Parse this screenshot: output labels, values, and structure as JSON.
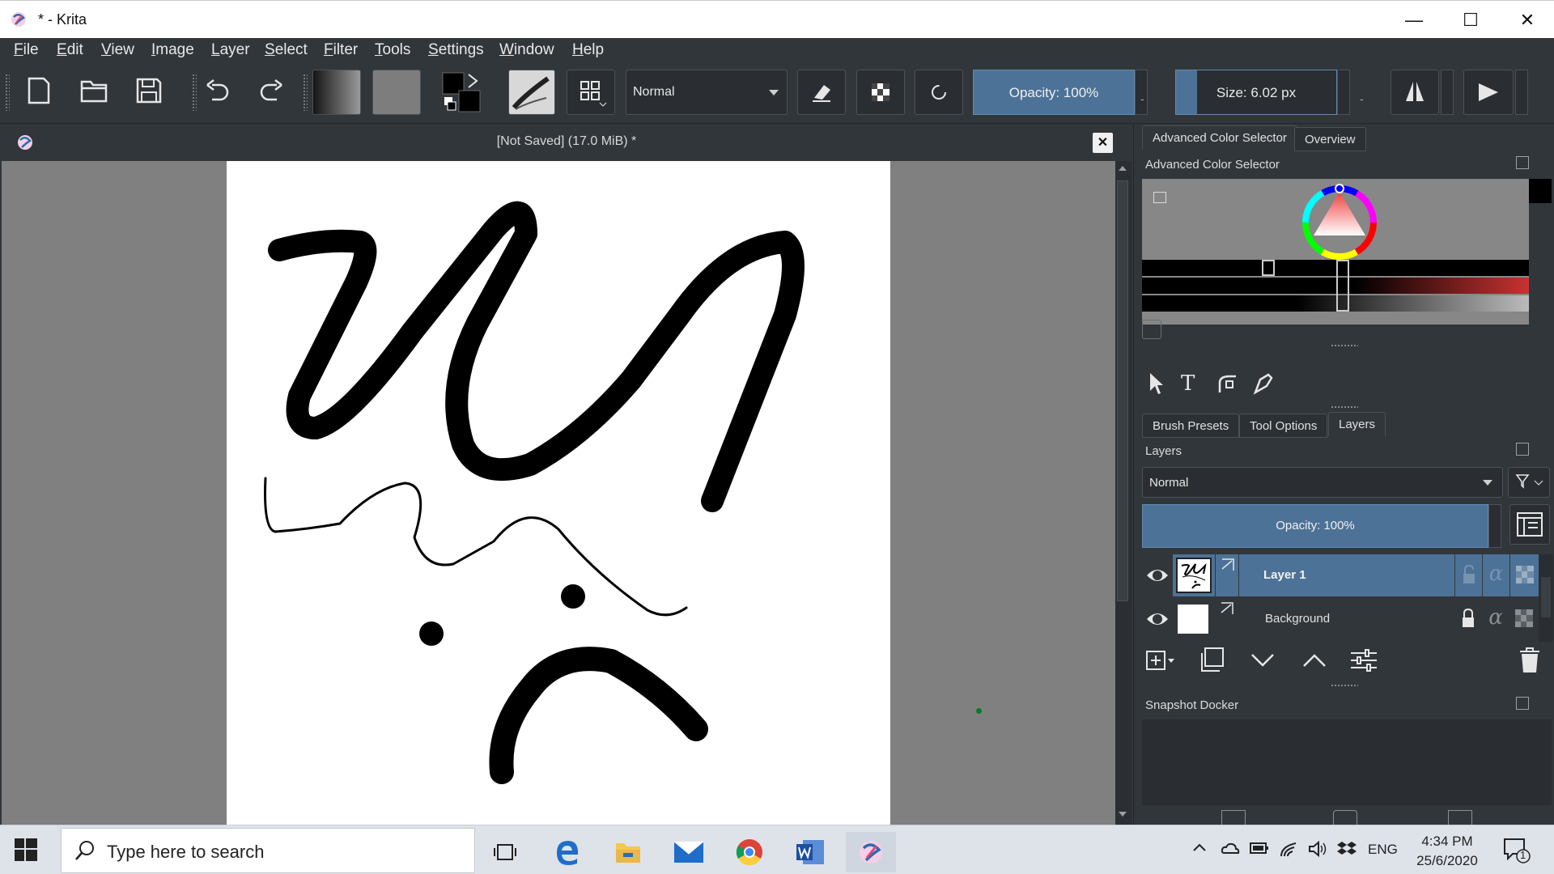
{
  "window": {
    "title": "* - Krita",
    "minimize_glyph": "—",
    "maximize_glyph": "☐",
    "close_glyph": "✕"
  },
  "menu": [
    "File",
    "Edit",
    "View",
    "Image",
    "Layer",
    "Select",
    "Filter",
    "Tools",
    "Settings",
    "Window",
    "Help"
  ],
  "toolbar": {
    "blend_mode": "Normal",
    "opacity_label": "Opacity: 100%",
    "size_label": "Size: 6.02 px",
    "spin_minus": "-",
    "icons": [
      "new-document-icon",
      "open-folder-icon",
      "save-icon",
      "undo-icon",
      "redo-icon",
      "gradient-icon",
      "pattern-icon",
      "color-swap-icon",
      "brush-preset-icon",
      "brush-editor-icon",
      "eraser-icon",
      "preserve-alpha-icon",
      "reload-preset-icon",
      "mirror-horizontal-icon",
      "mirror-vertical-icon"
    ]
  },
  "document": {
    "header": "[Not Saved]  (17.0 MiB) *",
    "close_glyph": "✕"
  },
  "dockers": {
    "top_tabs": [
      "Advanced Color Selector",
      "Overview"
    ],
    "color_selector_title": "Advanced Color Selector",
    "middle_tabs": [
      "Brush Presets",
      "Tool Options",
      "Layers"
    ],
    "layers_title": "Layers",
    "layers_blend": "Normal",
    "layers_opacity": "Opacity:  100%",
    "layers": [
      {
        "name": "Layer 1",
        "selected": true
      },
      {
        "name": "Background",
        "selected": false
      }
    ],
    "snapshot_title": "Snapshot Docker"
  },
  "colors": {
    "chrome": "#31363b",
    "accent": "#4d7297",
    "canvas_bg": "#808080",
    "foreground": "#000000",
    "background": "#ffffff"
  },
  "taskbar": {
    "search_placeholder": "Type here to search",
    "language": "ENG",
    "time": "4:34 PM",
    "date": "25/6/2020",
    "notification_count": "1"
  }
}
